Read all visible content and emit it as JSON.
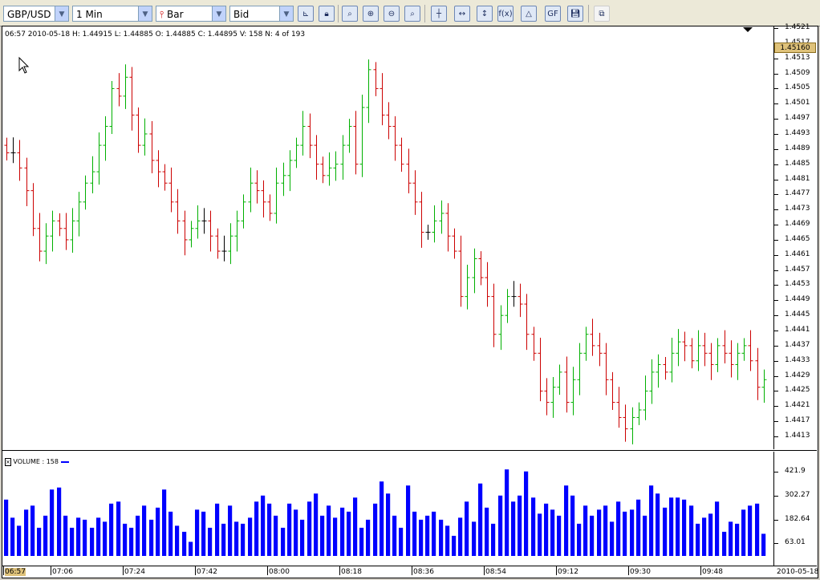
{
  "toolbar": {
    "symbol": "GBP/USD",
    "interval": "1 Min",
    "chart_type": "Bar",
    "price_type": "Bid",
    "buttons": [
      "chart-settings",
      "lock",
      "zoom-fit",
      "zoom-in",
      "zoom-out",
      "zoom-reset",
      "crosshair",
      "horizontal-scale",
      "vertical-scale",
      "indicators",
      "drawing-tools",
      "gann-fibonacci",
      "save-template",
      "new-window"
    ]
  },
  "info_line": "06:57 2010-05-18 H: 1.44915 L: 1.44885 O: 1.44885 C: 1.44895 V: 158 N: 4 of 193",
  "current_price": "1.45160",
  "price_axis": [
    "1.4521",
    "1.4517",
    "1.4513",
    "1.4509",
    "1.4505",
    "1.4501",
    "1.4497",
    "1.4493",
    "1.4489",
    "1.4485",
    "1.4481",
    "1.4477",
    "1.4473",
    "1.4469",
    "1.4465",
    "1.4461",
    "1.4457",
    "1.4453",
    "1.4449",
    "1.4445",
    "1.4441",
    "1.4437",
    "1.4433",
    "1.4429",
    "1.4425",
    "1.4421",
    "1.4417",
    "1.4413"
  ],
  "volume_label": "VOLUME : 158",
  "volume_axis": [
    "421.9",
    "302.27",
    "182.64",
    "63.01"
  ],
  "time_axis": [
    "06:57",
    "07:06",
    "07:24",
    "07:42",
    "08:00",
    "08:18",
    "08:36",
    "08:54",
    "09:12",
    "09:30",
    "09:48"
  ],
  "date_label": "2010-05-18",
  "colors": {
    "up": "#00b000",
    "down": "#cc0000",
    "volume": "#0000ff"
  },
  "chart_data": {
    "type": "bar",
    "ylim": [
      1.4411,
      1.4523
    ],
    "closes": [
      1.4488,
      1.4488,
      1.4484,
      1.4478,
      1.4468,
      1.4462,
      1.4466,
      1.447,
      1.4468,
      1.4465,
      1.447,
      1.4475,
      1.448,
      1.4483,
      1.449,
      1.4495,
      1.4505,
      1.4503,
      1.4508,
      1.4498,
      1.449,
      1.4493,
      1.4486,
      1.4483,
      1.448,
      1.4475,
      1.447,
      1.4465,
      1.4468,
      1.447,
      1.447,
      1.4466,
      1.4462,
      1.4462,
      1.4466,
      1.447,
      1.4475,
      1.448,
      1.4478,
      1.4475,
      1.4472,
      1.448,
      1.4482,
      1.4486,
      1.449,
      1.4495,
      1.449,
      1.4485,
      1.4482,
      1.4484,
      1.4485,
      1.449,
      1.4495,
      1.4485,
      1.45,
      1.451,
      1.4505,
      1.4498,
      1.4495,
      1.449,
      1.4485,
      1.448,
      1.4475,
      1.4467,
      1.4467,
      1.447,
      1.4472,
      1.4466,
      1.4462,
      1.445,
      1.4455,
      1.446,
      1.4455,
      1.445,
      1.444,
      1.4445,
      1.445,
      1.445,
      1.4448,
      1.444,
      1.4435,
      1.4425,
      1.4422,
      1.4426,
      1.443,
      1.4422,
      1.4428,
      1.4435,
      1.444,
      1.4437,
      1.4435,
      1.4428,
      1.4422,
      1.4418,
      1.4415,
      1.4418,
      1.442,
      1.4425,
      1.443,
      1.4432,
      1.443,
      1.4435,
      1.4438,
      1.4437,
      1.4433,
      1.4437,
      1.4435,
      1.4432,
      1.4437,
      1.4435,
      1.4432,
      1.4435,
      1.4437,
      1.4433,
      1.4426,
      1.4428
    ],
    "volumes": [
      280,
      190,
      150,
      230,
      250,
      140,
      200,
      330,
      340,
      200,
      140,
      190,
      180,
      140,
      190,
      170,
      260,
      270,
      160,
      140,
      200,
      250,
      180,
      240,
      330,
      220,
      150,
      120,
      70,
      230,
      220,
      140,
      260,
      160,
      250,
      170,
      160,
      190,
      270,
      300,
      260,
      200,
      140,
      260,
      230,
      180,
      270,
      310,
      200,
      250,
      190,
      240,
      220,
      290,
      140,
      180,
      260,
      370,
      310,
      200,
      140,
      350,
      220,
      180,
      200,
      220,
      180,
      150,
      100,
      190,
      270,
      170,
      360,
      240,
      160,
      300,
      430,
      270,
      300,
      420,
      290,
      210,
      260,
      230,
      200,
      350,
      300,
      160,
      250,
      200,
      230,
      250,
      170,
      270,
      220,
      230,
      280,
      200,
      350,
      310,
      240,
      290,
      290,
      280,
      250,
      160,
      190,
      210,
      270,
      120,
      170,
      160,
      230,
      250,
      260,
      110
    ]
  }
}
